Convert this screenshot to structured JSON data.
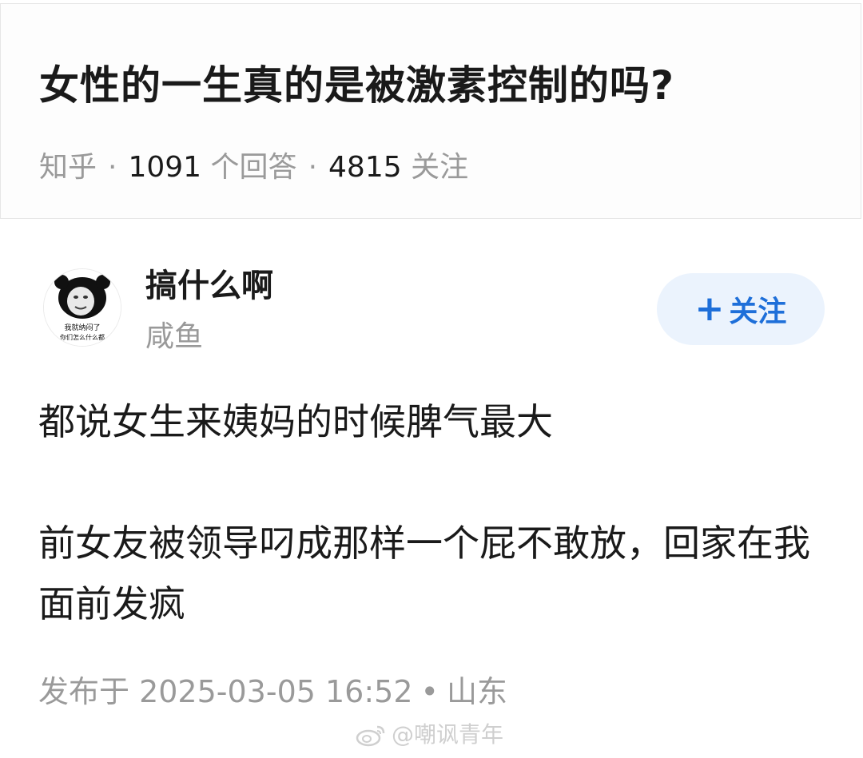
{
  "question": {
    "title": "女性的一生真的是被激素控制的吗?",
    "source": "知乎",
    "answer_count": "1091",
    "answer_label": "个回答",
    "follower_count": "4815",
    "follower_label": "关注"
  },
  "author": {
    "name": "搞什么啊",
    "bio": "咸鱼",
    "avatar_caption_line1": "我就纳闷了",
    "avatar_caption_line2": "你们怎么什么都"
  },
  "follow_button": {
    "icon": "plus-icon",
    "label": "关注"
  },
  "answer": {
    "paragraphs": [
      "都说女生来姨妈的时候脾气最大",
      "前女友被领导叼成那样一个屁不敢放，回家在我面前发疯"
    ]
  },
  "publish": {
    "date_text": "发布于 2025-03-05 16:52",
    "location": "山东"
  },
  "watermark": {
    "text": "@嘲讽青年",
    "icon": "weibo-logo-icon"
  },
  "colors": {
    "accent": "#1e6fd9",
    "follow_bg": "#ebf3fd",
    "text_primary": "#1a1a1a",
    "text_secondary": "#9a9a9a"
  }
}
